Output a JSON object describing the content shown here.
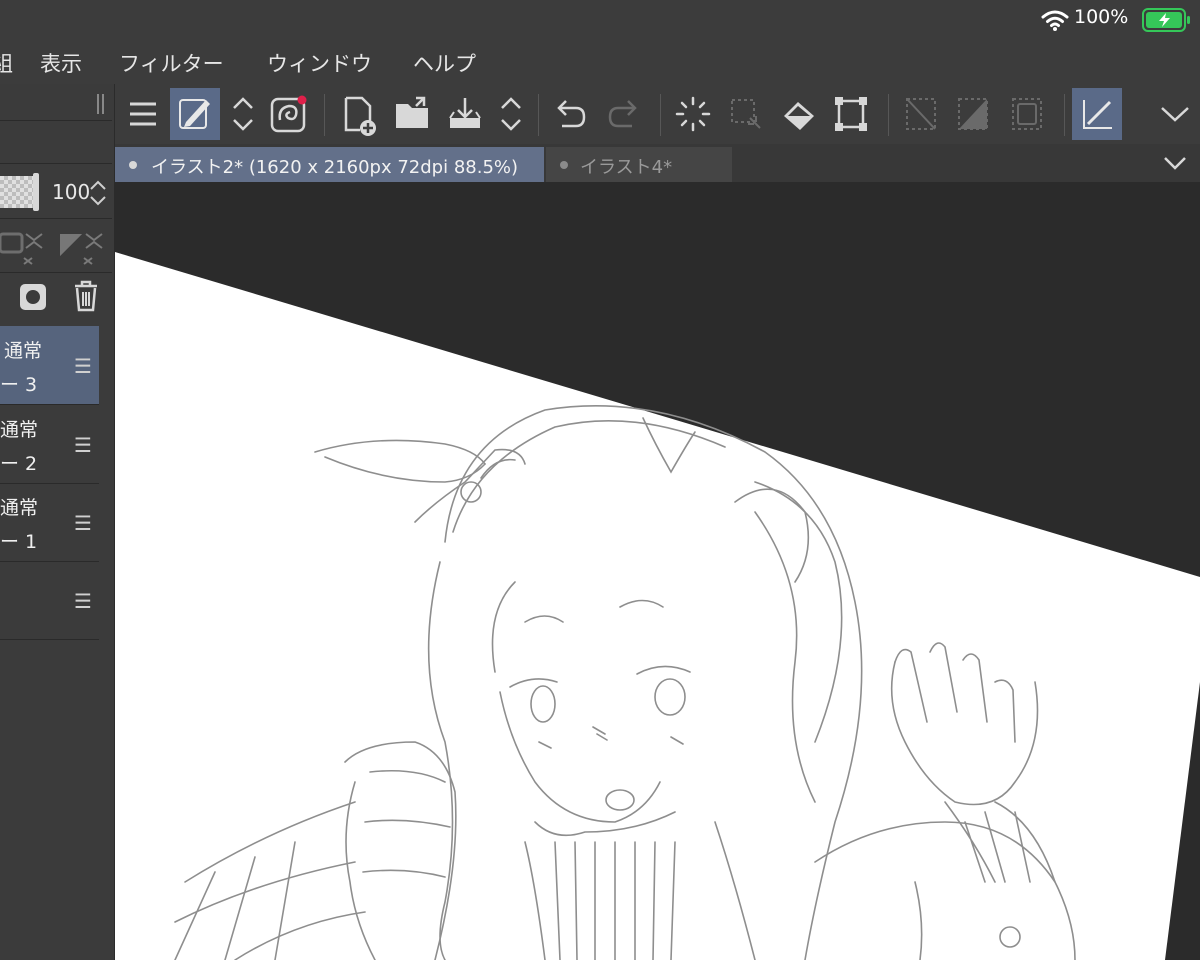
{
  "status": {
    "battery_percent": "100%",
    "battery_level": 1.0,
    "wifi_icon": "wifi-icon",
    "battery_icon": "battery-charging-icon"
  },
  "menu": {
    "items": [
      "組",
      "表示",
      "フィルター",
      "ウィンドウ",
      "ヘルプ"
    ]
  },
  "layer_panel": {
    "opacity": "100",
    "layers": [
      {
        "mode": "通常",
        "name": "ー 3",
        "selected": true
      },
      {
        "mode": "通常",
        "name": "ー 2",
        "selected": false
      },
      {
        "mode": "通常",
        "name": "ー 1",
        "selected": false
      },
      {
        "mode": "",
        "name": "",
        "selected": false
      }
    ],
    "menu_glyph": "☰"
  },
  "toolbar": {
    "icons": [
      "menu-icon",
      "pen-tool-icon",
      "tool-switch-icon",
      "companion-icon",
      "new-file-icon",
      "open-folder-icon",
      "save-icon",
      "file-switch-icon",
      "undo-icon",
      "redo-icon",
      "loading-icon",
      "select-clear-icon",
      "fill-icon",
      "transform-icon",
      "deselect-icon",
      "invert-selection-icon",
      "selection-border-icon",
      "ruler-snap-icon",
      "expand-icon"
    ]
  },
  "tabs": [
    {
      "label": "イラスト2* (1620 x 2160px 72dpi 88.5%)",
      "active": true
    },
    {
      "label": "イラスト4*",
      "active": false
    }
  ],
  "colors": {
    "accent": "#5a6a88",
    "chrome": "#3c3c3c",
    "canvas_bg": "#2b2b2b",
    "notify_dot": "#e0204a",
    "battery_green": "#35c759"
  }
}
